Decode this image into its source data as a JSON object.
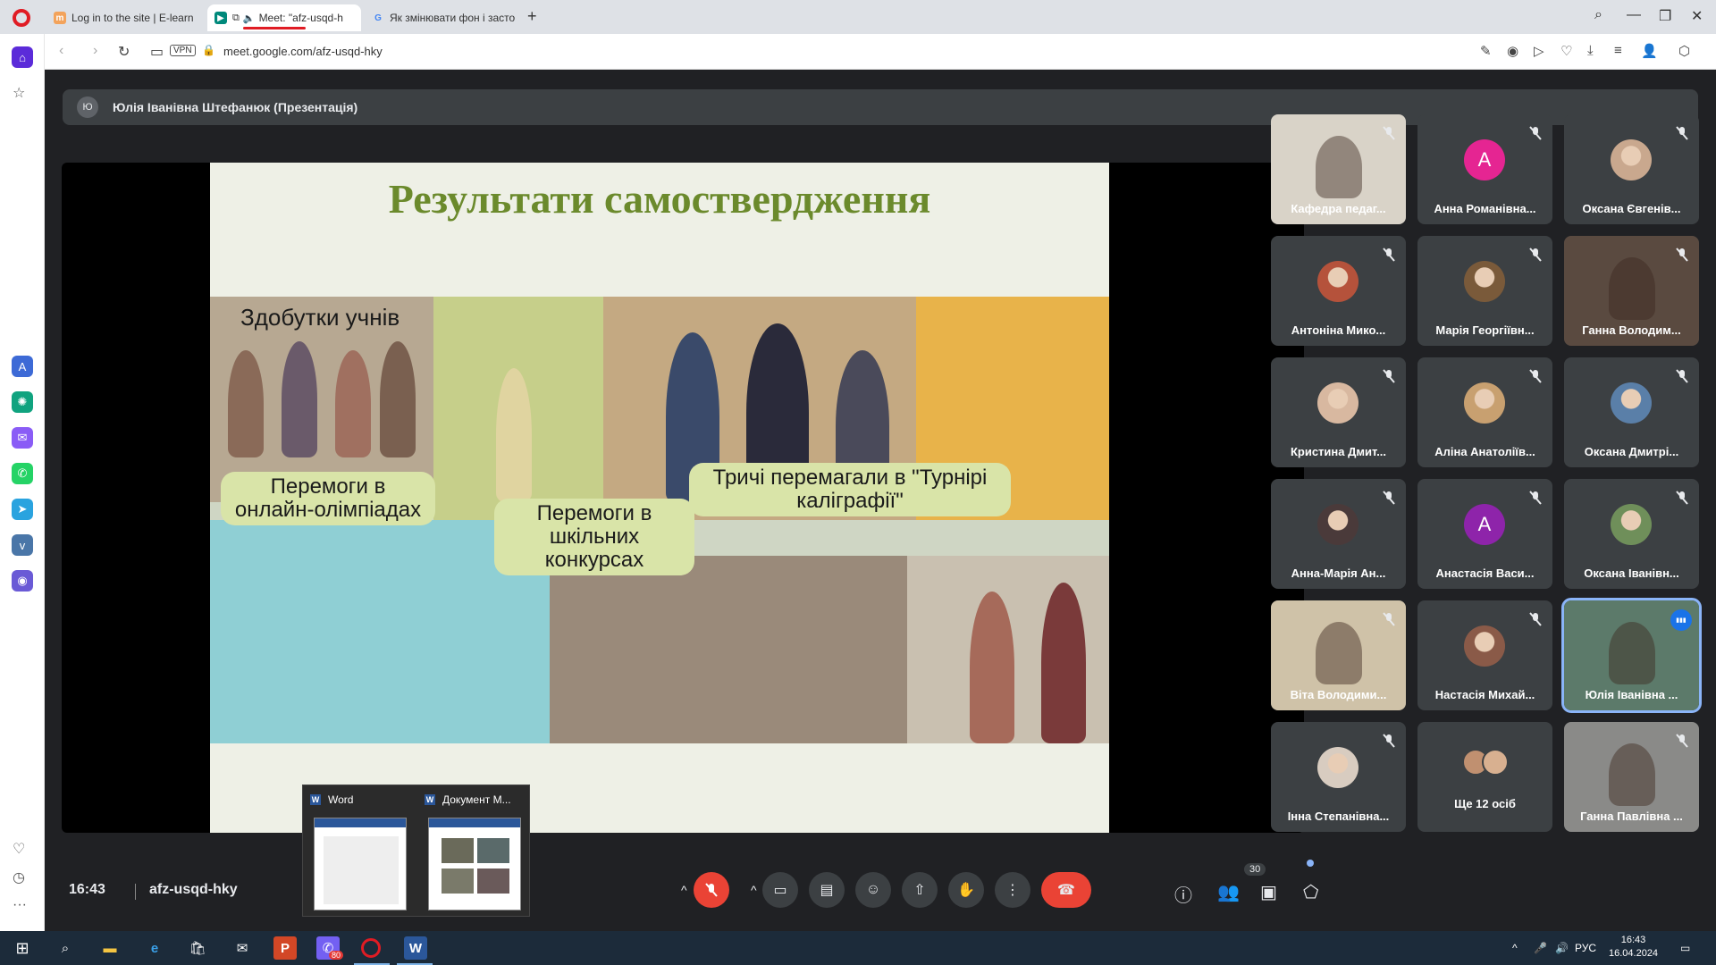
{
  "browser": {
    "tabs": [
      {
        "label": "Log in to the site | E-learn",
        "active": false
      },
      {
        "label": "Meet: \"afz-usqd-h",
        "active": true
      },
      {
        "label": "Як змінювати фон і засто",
        "active": false
      }
    ],
    "url": "meet.google.com/afz-usqd-hky",
    "vpn_label": "VPN"
  },
  "meet": {
    "presenter": {
      "initial": "Ю",
      "label": "Юлія Іванівна Штефанюк (Презентація)"
    },
    "slide": {
      "title": "Результати самоствердження",
      "labels": {
        "achievements": "Здобутки учнів",
        "olympiads": "Перемоги в онлайн-олімпіадах",
        "school_contests": "Перемоги в шкільних конкурсах",
        "calligraphy": "Тричі перемагали в \"Турнірі каліграфії\""
      }
    },
    "participants": [
      {
        "name": "Кафедра педаг...",
        "type": "video",
        "muted": true
      },
      {
        "name": "Анна Романівна...",
        "type": "letter",
        "initial": "А",
        "color": "#e52592",
        "muted": true
      },
      {
        "name": "Оксана Євгенів...",
        "type": "photo",
        "color": "#c9a88e",
        "muted": true
      },
      {
        "name": "Антоніна Мико...",
        "type": "photo",
        "color": "#b5523b",
        "muted": true
      },
      {
        "name": "Марія Георгіївн...",
        "type": "photo",
        "color": "#7a5a3a",
        "muted": true
      },
      {
        "name": "Ганна Володим...",
        "type": "video",
        "muted": true
      },
      {
        "name": "Кристина Дмит...",
        "type": "photo",
        "color": "#d8b8a0",
        "muted": true
      },
      {
        "name": "Аліна Анатоліїв...",
        "type": "photo",
        "color": "#c8a070",
        "muted": true
      },
      {
        "name": "Оксана Дмитрі...",
        "type": "photo",
        "color": "#5a7fa8",
        "muted": true
      },
      {
        "name": "Анна-Марія Ан...",
        "type": "photo",
        "color": "#4a3a3a",
        "muted": true
      },
      {
        "name": "Анастасія Васи...",
        "type": "letter",
        "initial": "А",
        "color": "#8e24aa",
        "muted": true
      },
      {
        "name": "Оксана Іванівн...",
        "type": "photo",
        "color": "#6f8f5a",
        "muted": true
      },
      {
        "name": "Віта Володими...",
        "type": "video",
        "muted": true
      },
      {
        "name": "Настасія Михай...",
        "type": "photo",
        "color": "#8a5a48",
        "muted": true
      },
      {
        "name": "Юлія Іванівна ...",
        "type": "video",
        "muted": false,
        "speaking": true
      },
      {
        "name": "Інна Степанівна...",
        "type": "photo",
        "color": "#d8ccc0",
        "muted": true
      },
      {
        "name": "Ще 12 осіб",
        "type": "more",
        "muted": false
      },
      {
        "name": "Ганна Павлівна ...",
        "type": "video",
        "muted": true
      }
    ],
    "meeting_time": "16:43",
    "meeting_code": "afz-usqd-hky",
    "people_count": "30"
  },
  "taskbar_preview": {
    "windows": [
      {
        "title": "Word"
      },
      {
        "title": "Документ М..."
      }
    ]
  },
  "taskbar": {
    "language": "РУС",
    "time": "16:43",
    "date": "16.04.2024",
    "badge": "80"
  }
}
